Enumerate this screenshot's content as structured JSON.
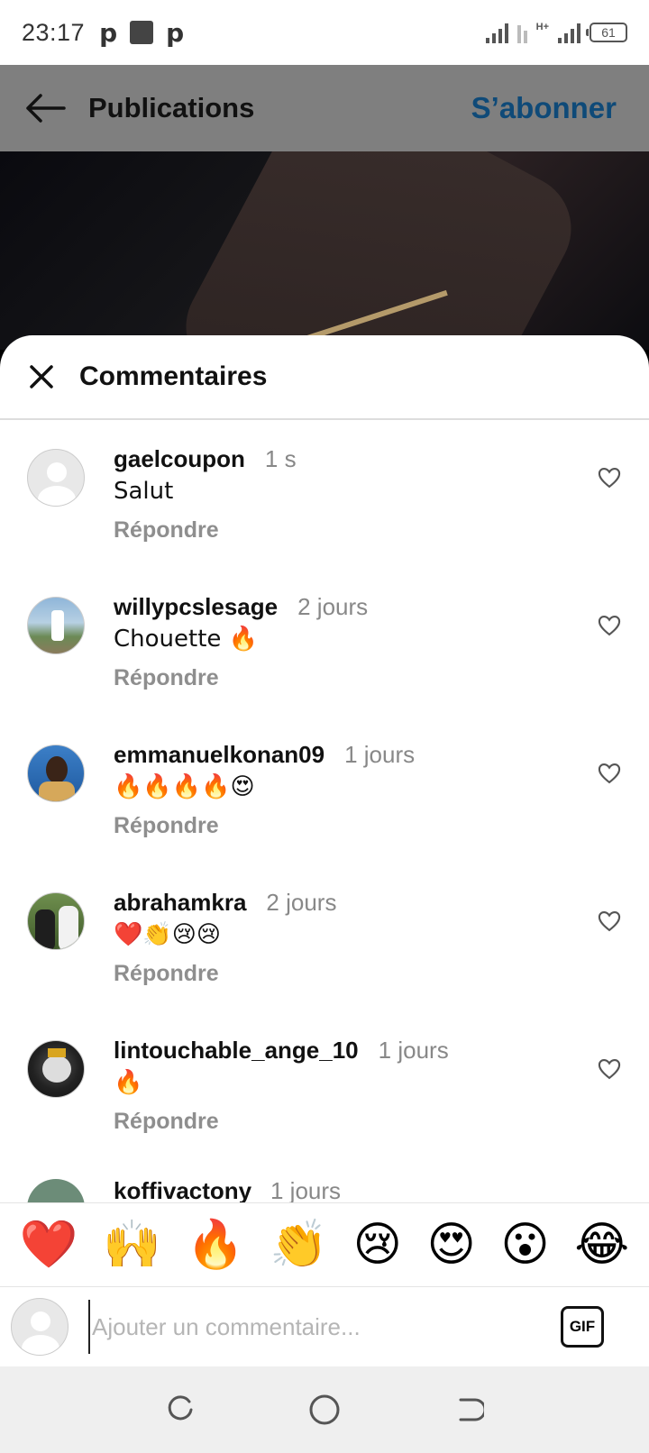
{
  "status_bar": {
    "time": "23:17",
    "notifications": [
      "p",
      "p"
    ],
    "network": "H+",
    "battery": "61"
  },
  "header": {
    "title": "Publications",
    "subscribe_label": "S’abonner"
  },
  "comments_sheet": {
    "title": "Commentaires",
    "reply_label": "Répondre",
    "comments": [
      {
        "user": "gaelcoupon",
        "time": "1 s",
        "text": "Salut"
      },
      {
        "user": "willypcslesage",
        "time": "2 jours",
        "text": "Chouette 🔥"
      },
      {
        "user": "emmanuelkonan09",
        "time": "1 jours",
        "text": "🔥🔥🔥🔥😍"
      },
      {
        "user": "abrahamkra",
        "time": "2 jours",
        "text": "❤️👏😢😢"
      },
      {
        "user": "lintouchable_ange_10",
        "time": "1 jours",
        "text": "🔥"
      }
    ],
    "cut_comment": {
      "user": "koffivactony",
      "time": "1 jours"
    }
  },
  "emoji_bar": [
    "❤️",
    "🙌",
    "🔥",
    "👏",
    "😢",
    "😍",
    "😮",
    "😂"
  ],
  "input": {
    "placeholder": "Ajouter un commentaire...",
    "gif_label": "GIF"
  }
}
